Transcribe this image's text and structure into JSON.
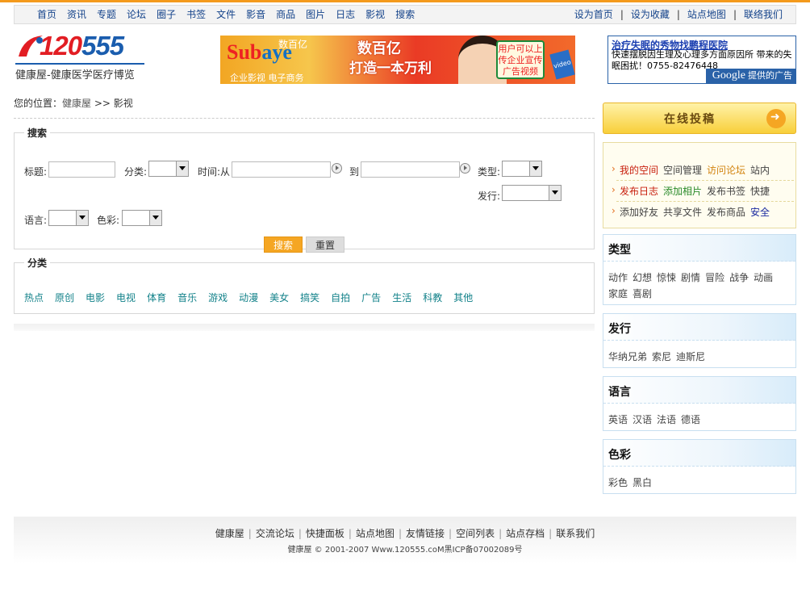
{
  "topnav": {
    "left": [
      "首页",
      "资讯",
      "专题",
      "论坛",
      "圈子",
      "书签",
      "文件",
      "影音",
      "商品",
      "图片",
      "日志",
      "影视",
      "搜索"
    ],
    "right": [
      "设为首页",
      "设为收藏",
      "站点地图",
      "联络我们"
    ],
    "separator": "|"
  },
  "logo": {
    "number_red": "120",
    "number_blue": "555",
    "tagline": "健康屋-健康医学医疗博览"
  },
  "banner": {
    "brand_cn": "数百亿",
    "brand_en": "Sub",
    "brand_en2": "aye",
    "sub": "企业影视 电子商务",
    "headline1": "数百亿",
    "headline2": "打造一本万利",
    "bubble": "用户可以上传企业宣传广告视频",
    "tv": "video"
  },
  "google_ad": {
    "title": "治疗失眠的秀物找鹏程医院",
    "desc": "快速摆脱因生理及心理多方面原因所 带来的失眠困扰！0755-82476448",
    "badge_logo": "Google",
    "badge_text": "提供的广告"
  },
  "breadcrumb": {
    "prefix": "您的位置：",
    "home": "健康屋",
    "sep": ">>",
    "current": "影视"
  },
  "search": {
    "legend": "搜索",
    "title_label": "标题:",
    "category_label": "分类:",
    "time_label": "时间:从",
    "to_label": "到",
    "type_label": "类型:",
    "publisher_label": "发行:",
    "language_label": "语言:",
    "color_label": "色彩:",
    "search_btn": "搜索",
    "reset_btn": "重置"
  },
  "categories": {
    "legend": "分类",
    "items": [
      "热点",
      "原创",
      "电影",
      "电视",
      "体育",
      "音乐",
      "游戏",
      "动漫",
      "美女",
      "搞笑",
      "自拍",
      "广告",
      "生活",
      "科教",
      "其他"
    ]
  },
  "submit_btn": "在线投稿",
  "space": {
    "row1": [
      "我的空间",
      "空间管理",
      "访问论坛",
      "站内"
    ],
    "row2": [
      "发布日志",
      "添加相片",
      "发布书签",
      "快捷"
    ],
    "row3": [
      "添加好友",
      "共享文件",
      "发布商品",
      "安全"
    ]
  },
  "panels": [
    {
      "title": "类型",
      "items": [
        "动作",
        "幻想",
        "惊悚",
        "剧情",
        "冒险",
        "战争",
        "动画",
        "家庭",
        "喜剧"
      ]
    },
    {
      "title": "发行",
      "items": [
        "华纳兄弟",
        "索尼",
        "迪斯尼"
      ]
    },
    {
      "title": "语言",
      "items": [
        "英语",
        "汉语",
        "法语",
        "德语"
      ]
    },
    {
      "title": "色彩",
      "items": [
        "彩色",
        "黑白"
      ]
    }
  ],
  "footer": {
    "links": [
      "健康屋",
      "交流论坛",
      "快捷面板",
      "站点地图",
      "友情链接",
      "空间列表",
      "站点存档",
      "联系我们"
    ],
    "copyright": "健康屋 © 2001-2007 Www.120555.coM黑ICP备07002089号"
  },
  "colors": {
    "accent": "#f49a1c",
    "link": "#13428a",
    "category": "#13828a",
    "space_red": "#c8200f",
    "space_green": "#2a8a2a"
  }
}
